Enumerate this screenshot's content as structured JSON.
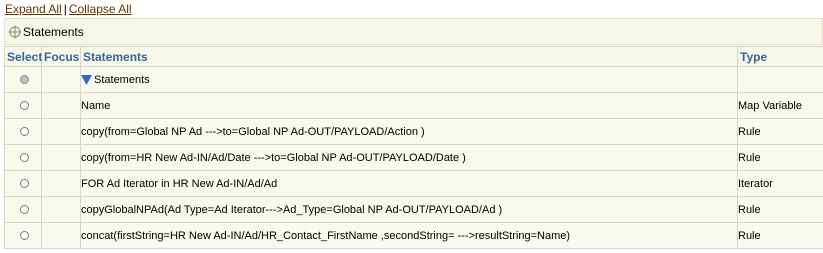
{
  "links": {
    "expand_all": "Expand All",
    "separator": "|",
    "collapse_all": "Collapse All"
  },
  "breadcrumb": {
    "label": "Statements",
    "icon": "focus-crosshair-icon"
  },
  "table": {
    "headers": {
      "select": "Select",
      "focus": "Focus",
      "statements": "Statements",
      "type": "Type"
    },
    "rows": [
      {
        "statement": "Statements",
        "type": "",
        "selected": false,
        "disabled": true,
        "expandable": true
      },
      {
        "statement": "Name",
        "type": "Map Variable",
        "selected": false,
        "disabled": false
      },
      {
        "statement": "copy(from=Global NP Ad --->to=Global NP Ad-OUT/PAYLOAD/Action )",
        "type": "Rule",
        "selected": false,
        "disabled": false
      },
      {
        "statement": "copy(from=HR New Ad-IN/Ad/Date --->to=Global NP Ad-OUT/PAYLOAD/Date )",
        "type": "Rule",
        "selected": false,
        "disabled": false
      },
      {
        "statement": "FOR Ad Iterator in HR New Ad-IN/Ad/Ad",
        "type": "Iterator",
        "selected": false,
        "disabled": false
      },
      {
        "statement": "copyGlobalNPAd(Ad Type=Ad Iterator--->Ad_Type=Global NP Ad-OUT/PAYLOAD/Ad )",
        "type": "Rule",
        "selected": false,
        "disabled": false
      },
      {
        "statement": "concat(firstString=HR New Ad-IN/Ad/HR_Contact_FirstName ,secondString= --->resultString=Name)",
        "type": "Rule",
        "selected": false,
        "disabled": false
      }
    ]
  },
  "colors": {
    "header_text": "#336699",
    "link": "#663300",
    "row_bg": "#f9f9ef",
    "header_bg": "#f7f7e7",
    "expand_icon": "#3366cc"
  }
}
